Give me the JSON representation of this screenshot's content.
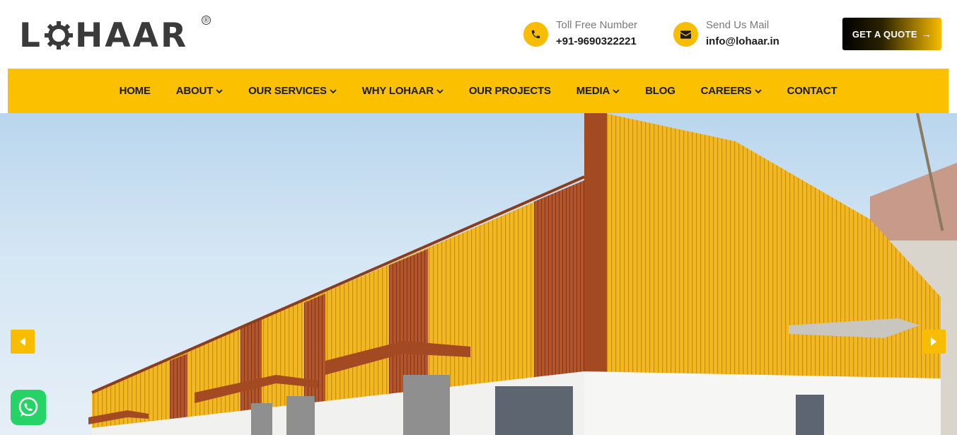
{
  "brand": {
    "name": "LOHAAR",
    "registered": "®"
  },
  "contact": {
    "phone": {
      "label": "Toll Free Number",
      "value": "+91-9690322221",
      "icon": "phone-icon"
    },
    "mail": {
      "label": "Send Us Mail",
      "value": "info@lohaar.in",
      "icon": "envelope-icon"
    }
  },
  "cta": {
    "label": "GET A QUOTE",
    "icon": "arrow-right-icon"
  },
  "nav": {
    "items": [
      {
        "label": "HOME",
        "dropdown": false
      },
      {
        "label": "ABOUT",
        "dropdown": true
      },
      {
        "label": "OUR SERVICES",
        "dropdown": true
      },
      {
        "label": "WHY LOHAAR",
        "dropdown": true
      },
      {
        "label": "OUR PROJECTS",
        "dropdown": false
      },
      {
        "label": "MEDIA",
        "dropdown": true
      },
      {
        "label": "BLOG",
        "dropdown": false
      },
      {
        "label": "CAREERS",
        "dropdown": true
      },
      {
        "label": "CONTACT",
        "dropdown": false
      }
    ]
  },
  "hero": {
    "image": "industrial-warehouse-photo"
  },
  "slider": {
    "prev_icon": "caret-left-icon",
    "next_icon": "caret-right-icon"
  },
  "whatsapp": {
    "icon": "whatsapp-icon"
  },
  "colors": {
    "accent": "#fbc000",
    "dark": "#1a1a1a",
    "muted": "#7a7a7a"
  }
}
